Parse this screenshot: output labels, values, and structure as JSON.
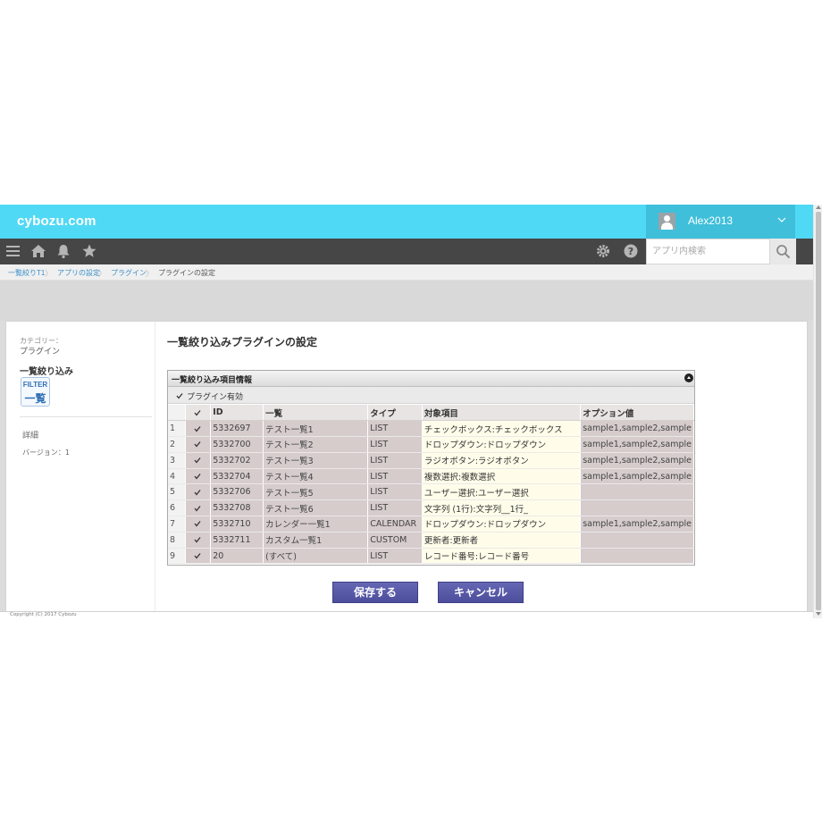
{
  "header": {
    "logo": "cybozu.com",
    "user_name": "Alex2013",
    "search_placeholder": "アプリ内検索",
    "nav_icons": [
      "menu-icon",
      "home-icon",
      "bell-icon",
      "star-icon",
      "gear-icon",
      "help-icon",
      "search-icon"
    ],
    "accent_color": "#4fd9f5",
    "nav_color": "#464646"
  },
  "breadcrumb": {
    "items": [
      "一覧絞りT1",
      "アプリの設定",
      "プラグイン",
      "プラグインの設定"
    ]
  },
  "sidebar": {
    "category_label": "カテゴリー：",
    "category_value": "プラグイン",
    "plugin_name": "一覧絞り込み",
    "icon_line1": "FILTER",
    "icon_line2": "一覧",
    "detail_label": "詳細",
    "version_label": "バージョン：1"
  },
  "main": {
    "title": "一覧絞り込みプラグインの設定",
    "panel_title": "一覧絞り込み項目情報",
    "plugin_enabled_label": "プラグイン有効",
    "plugin_enabled": true
  },
  "grid": {
    "columns": [
      "",
      "✔",
      "ID",
      "一覧",
      "タイプ",
      "対象項目",
      "オプション値"
    ],
    "rows": [
      {
        "no": "1",
        "checked": true,
        "id": "5332697",
        "list": "テスト一覧1",
        "type": "LIST",
        "target": "チェックボックス:チェックボックス",
        "option": "sample1,sample2,sample"
      },
      {
        "no": "2",
        "checked": true,
        "id": "5332700",
        "list": "テスト一覧2",
        "type": "LIST",
        "target": "ドロップダウン:ドロップダウン",
        "option": "sample1,sample2,sample"
      },
      {
        "no": "3",
        "checked": true,
        "id": "5332702",
        "list": "テスト一覧3",
        "type": "LIST",
        "target": "ラジオボタン:ラジオボタン",
        "option": "sample1,sample2,sample"
      },
      {
        "no": "4",
        "checked": true,
        "id": "5332704",
        "list": "テスト一覧4",
        "type": "LIST",
        "target": "複数選択:複数選択",
        "option": "sample1,sample2,sample"
      },
      {
        "no": "5",
        "checked": true,
        "id": "5332706",
        "list": "テスト一覧5",
        "type": "LIST",
        "target": "ユーザー選択:ユーザー選択",
        "option": ""
      },
      {
        "no": "6",
        "checked": true,
        "id": "5332708",
        "list": "テスト一覧6",
        "type": "LIST",
        "target": "文字列 (1行):文字列__1行_",
        "option": ""
      },
      {
        "no": "7",
        "checked": true,
        "id": "5332710",
        "list": "カレンダー一覧1",
        "type": "CALENDAR",
        "target": "ドロップダウン:ドロップダウン",
        "option": "sample1,sample2,sample"
      },
      {
        "no": "8",
        "checked": true,
        "id": "5332711",
        "list": "カスタム一覧1",
        "type": "CUSTOM",
        "target": "更新者:更新者",
        "option": ""
      },
      {
        "no": "9",
        "checked": true,
        "id": "20",
        "list": "(すべて)",
        "type": "LIST",
        "target": "レコード番号:レコード番号",
        "option": ""
      }
    ]
  },
  "buttons": {
    "save": "保存する",
    "cancel": "キャンセル",
    "button_color": "#5557a6"
  },
  "footer": {
    "copyright": "Copyright (C) 2017 Cybozu"
  }
}
